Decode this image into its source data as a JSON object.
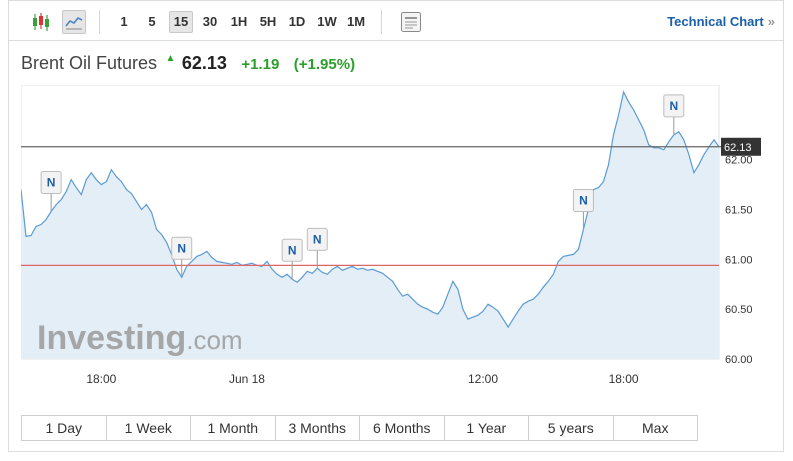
{
  "toolbar": {
    "intervals": [
      "1",
      "5",
      "15",
      "30",
      "1H",
      "5H",
      "1D",
      "1W",
      "1M"
    ],
    "selected_interval": "15",
    "icons": [
      "candlestick-chart-icon",
      "line-chart-icon",
      "layout-icon"
    ],
    "technical_chart_label": "Technical Chart",
    "technical_chart_arrow": "»"
  },
  "quote": {
    "name": "Brent Oil Futures",
    "price": "62.13",
    "change": "+1.19",
    "change_pct": "(+1.95%)",
    "up_color": "#2aa02a"
  },
  "chart_data": {
    "type": "area",
    "title": "",
    "xlabel": "",
    "ylabel": "",
    "ylim": [
      60.0,
      62.75
    ],
    "y_ticks": [
      "60.00",
      "60.50",
      "61.00",
      "61.50",
      "62.00"
    ],
    "x_ticks": [
      "18:00",
      "Jun 18",
      "12:00",
      "18:00"
    ],
    "last_price_label": "62.13",
    "last_price": 62.13,
    "previous_close": 60.94,
    "line_color": "#5b9bd5",
    "fill_color": "#e4eef6",
    "last_line_color": "#666666",
    "prev_close_color": "#e06666",
    "series": [
      {
        "values": [
          61.7,
          61.23,
          61.24,
          61.33,
          61.35,
          61.4,
          61.48,
          61.55,
          61.6,
          61.68,
          61.8,
          61.72,
          61.65,
          61.8,
          61.87,
          61.8,
          61.75,
          61.78,
          61.9,
          61.83,
          61.78,
          61.7,
          61.66,
          61.58,
          61.5,
          61.55,
          61.47,
          61.3,
          61.25,
          61.17,
          61.05,
          60.9,
          60.82,
          60.93,
          60.98,
          61.03,
          61.05,
          61.08,
          61.02,
          60.98,
          60.97,
          60.96,
          60.95,
          60.97,
          60.94,
          60.95,
          60.96,
          60.94,
          60.93,
          60.98,
          60.9,
          60.85,
          60.82,
          60.85,
          60.8,
          60.77,
          60.82,
          60.88,
          60.86,
          60.91,
          60.87,
          60.85,
          60.9,
          60.93,
          60.89,
          60.91,
          60.93,
          60.9,
          60.91,
          60.89,
          60.9,
          60.88,
          60.86,
          60.82,
          60.78,
          60.7,
          60.63,
          60.65,
          60.6,
          60.55,
          60.52,
          60.5,
          60.47,
          60.45,
          60.52,
          60.65,
          60.78,
          60.7,
          60.5,
          60.4,
          60.42,
          60.44,
          60.48,
          60.55,
          60.52,
          60.48,
          60.4,
          60.32,
          60.4,
          60.48,
          60.55,
          60.58,
          60.6,
          60.65,
          60.72,
          60.78,
          60.85,
          60.98,
          61.03,
          61.04,
          61.05,
          61.1,
          61.3,
          61.5,
          61.7,
          61.72,
          61.78,
          61.95,
          62.25,
          62.45,
          62.68,
          62.58,
          62.5,
          62.4,
          62.3,
          62.15,
          62.12,
          62.12,
          62.1,
          62.18,
          62.25,
          62.28,
          62.2,
          62.05,
          61.87,
          61.95,
          62.05,
          62.13,
          62.2,
          62.13
        ]
      }
    ],
    "news_markers": [
      {
        "label": "N",
        "index": 6
      },
      {
        "label": "N",
        "index": 32
      },
      {
        "label": "N",
        "index": 54
      },
      {
        "label": "N",
        "index": 59
      },
      {
        "label": "N",
        "index": 112
      },
      {
        "label": "N",
        "index": 130
      }
    ],
    "x_tick_indices": [
      16,
      45,
      92,
      120
    ],
    "watermark": "Investing.com"
  },
  "ranges": [
    "1 Day",
    "1 Week",
    "1 Month",
    "3 Months",
    "6 Months",
    "1 Year",
    "5 years",
    "Max"
  ]
}
